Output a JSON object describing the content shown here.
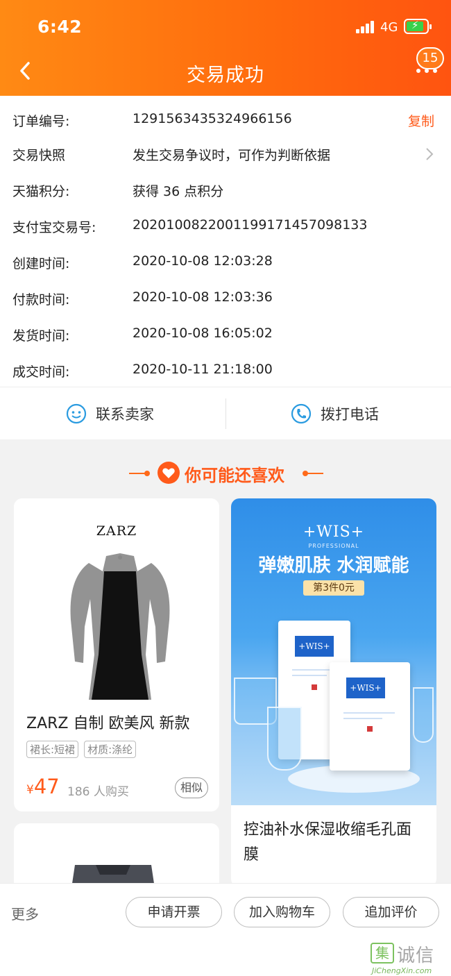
{
  "status_bar": {
    "time": "6:42",
    "network": "4G"
  },
  "header": {
    "title": "交易成功",
    "message_count": "15"
  },
  "order_info": [
    {
      "label": "订单编号:",
      "value": "1291563435324966156",
      "action": "复制"
    },
    {
      "label": "交易快照",
      "value": "发生交易争议时，可作为判断依据"
    },
    {
      "label": "天猫积分:",
      "value": "获得 36 点积分"
    },
    {
      "label": "支付宝交易号:",
      "value": "2020100822001199171457098133"
    },
    {
      "label": "创建时间:",
      "value": "2020-10-08 12:03:28"
    },
    {
      "label": "付款时间:",
      "value": "2020-10-08 12:03:36"
    },
    {
      "label": "发货时间:",
      "value": "2020-10-08 16:05:02"
    },
    {
      "label": "成交时间:",
      "value": "2020-10-11 21:18:00"
    }
  ],
  "contact": {
    "seller": "联系卖家",
    "phone": "拨打电话"
  },
  "recommend": {
    "title": "你可能还喜欢",
    "items": [
      {
        "brand": "ZARZ",
        "title": "ZARZ 自制 欧美风 新款",
        "tags": [
          "裙长:短裙",
          "材质:涤纶"
        ],
        "currency": "¥",
        "price": "47",
        "sold": "186 人购买",
        "similar": "相似"
      },
      {
        "brand": "+WIS+",
        "brand_sub": "PROFESSIONAL",
        "slogan": "弹嫩肌肤 水润赋能",
        "promo": "第3件0元",
        "title": "控油补水保湿收缩毛孔面膜"
      }
    ]
  },
  "bottom_bar": {
    "more": "更多",
    "buttons": [
      "申请开票",
      "加入购物车",
      "追加评价"
    ]
  },
  "watermark": {
    "mark": "集",
    "text": "诚信",
    "url": "JiChengXin.com"
  },
  "colors": {
    "accent": "#ff5a1a",
    "header_start": "#ff8a14",
    "header_end": "#ff5410",
    "contact_icon": "#2a9be0"
  }
}
